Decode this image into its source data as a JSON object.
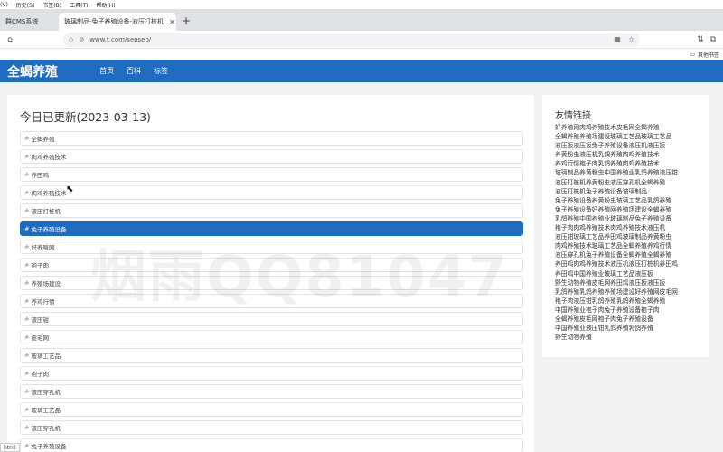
{
  "browser": {
    "menu": [
      "(V)",
      "历史(S)",
      "书签(B)",
      "工具(T)",
      "帮助(H)"
    ],
    "tabs": [
      {
        "label": "群CMS系统",
        "active": false
      },
      {
        "label": "玻璃制品-兔子养殖设备-液压打桩机",
        "active": true
      }
    ],
    "url": "www.t.com/seoseo/",
    "bookmarks_label": "其他书签",
    "status_text": "html"
  },
  "site": {
    "logo": "全蝎养殖",
    "nav": [
      "首页",
      "百科",
      "标签"
    ]
  },
  "main": {
    "title": "今日已更新(2023-03-13)",
    "items": [
      "全蝎养殖",
      "肉鸡养殖技术",
      "养田鸡",
      "肉鸡养殖技术",
      "液压打桩机",
      "兔子养殖设备",
      "好养殖网",
      "袍子肉",
      "养殖场建设",
      "养鸡行情",
      "液压钳",
      "皮毛网",
      "玻璃工艺品",
      "袍子肉",
      "液压穿孔机",
      "玻璃工艺品",
      "液压穿孔机",
      "兔子养殖设备"
    ],
    "selected_index": 5
  },
  "sidebar": {
    "title": "友情链接",
    "links": [
      "好养殖网肉鸡养殖技术皮毛网全蝎养殖",
      "全蝎养殖养殖场建设玻璃工艺品玻璃工艺品",
      "液压扳液压扳兔子养殖设备液压机液压扳",
      "养黄粉虫液压机乳鸽养殖肉鸡养殖技术",
      "养鸡行情袍子肉乳鸽养殖肉鸡养殖技术",
      "玻璃制品养黄粉虫中国养殖业乳鸽养殖液压钳",
      "液压打桩机养黄粉虫液压穿孔机全蝎养殖",
      "液压打桩机兔子养殖设备玻璃制品",
      "兔子养殖设备养黄粉虫玻璃工艺品乳鸽养殖",
      "兔子养殖设备好养殖网养殖场建设全蝎养殖",
      "乳鸽养殖中国养殖业玻璃制品兔子养殖设备",
      "袍子肉肉鸡养殖技术肉鸡养殖技术液压机",
      "液压钳玻璃工艺品养田鸡玻璃制品养黄粉虫",
      "肉鸡养殖技术玻璃工艺品全蝎养殖养鸡行情",
      "液压穿孔机兔子养殖设备全蝎养殖全蝎养殖",
      "养田鸡肉鸡养殖技术液压机液压打桩机养田鸡",
      "养田鸡中国养殖业玻璃工艺品液压扳",
      "野生动物养殖皮毛网养田鸡液压扳液压扳",
      "乳鸽养殖乳鸽养殖养殖场建设好养殖网皮毛网",
      "袍子肉液压钳乳鸽养殖乳鸽养殖全蝎养殖",
      "中国养殖业袍子肉兔子养殖设备袍子肉",
      "全蝎养殖皮毛网袍子肉兔子养殖设备",
      "中国养殖业液压钳乳鸽养殖乳鸽养殖",
      "野生动物养殖"
    ]
  },
  "watermark": "烟雨QQ81047"
}
